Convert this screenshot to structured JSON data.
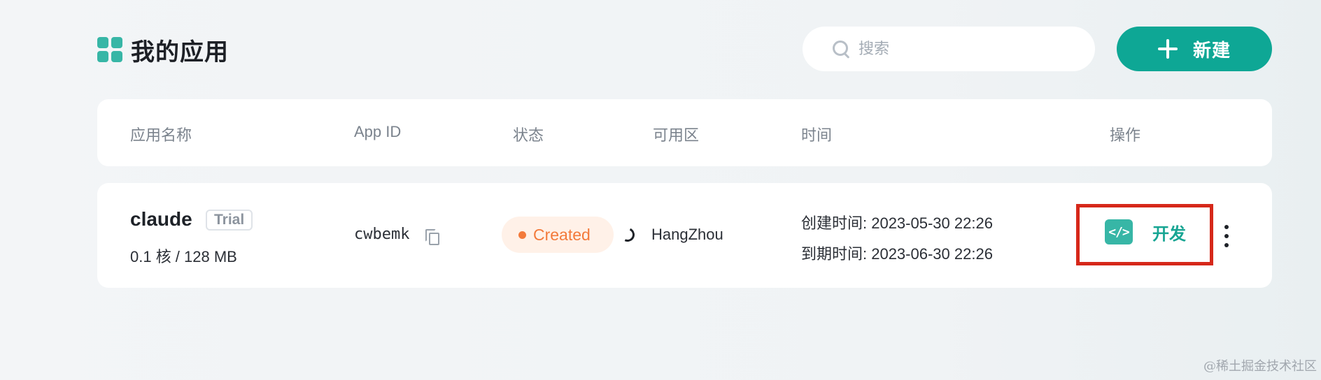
{
  "header": {
    "icon": "app-grid-icon",
    "title": "我的应用",
    "search": {
      "placeholder": "搜索",
      "value": ""
    },
    "new_button": {
      "label": "新建",
      "icon": "plus-icon"
    }
  },
  "colors": {
    "accent": "#0ea795",
    "status_created": "#f37a3b",
    "highlight": "#d6281a"
  },
  "table": {
    "columns": [
      "应用名称",
      "App ID",
      "状态",
      "可用区",
      "时间",
      "操作"
    ],
    "rows": [
      {
        "name": "claude",
        "tier": "Trial",
        "spec": "0.1 核 / 128 MB",
        "app_id": "cwbemk",
        "status": "Created",
        "zone": "HangZhou",
        "created": "创建时间: 2023-05-30 22:26",
        "expires": "到期时间: 2023-06-30 22:26",
        "action_label": "开发",
        "action_icon": "code-icon"
      }
    ]
  },
  "watermark": "@稀土掘金技术社区"
}
